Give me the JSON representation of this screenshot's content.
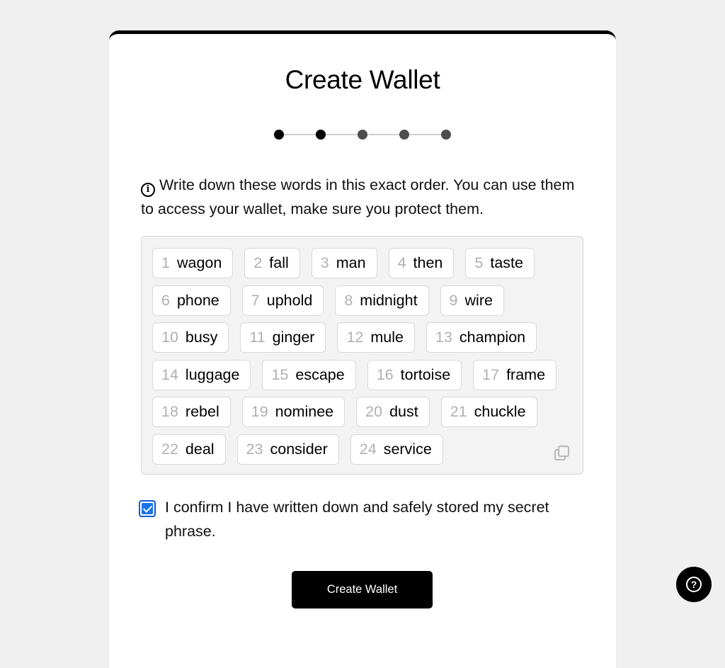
{
  "page": {
    "title": "Create Wallet"
  },
  "stepper": {
    "total_steps": 5,
    "completed_steps": 2,
    "colors": {
      "done": "#000000",
      "pending": "#4d4d4d",
      "line": "#cfcfcf"
    }
  },
  "info": {
    "icon": "info-circle-icon",
    "text": "Write down these words in this exact order. You can use them to access your wallet, make sure you protect them."
  },
  "seed_phrase": {
    "words": [
      {
        "num": "1",
        "word": "wagon"
      },
      {
        "num": "2",
        "word": "fall"
      },
      {
        "num": "3",
        "word": "man"
      },
      {
        "num": "4",
        "word": "then"
      },
      {
        "num": "5",
        "word": "taste"
      },
      {
        "num": "6",
        "word": "phone"
      },
      {
        "num": "7",
        "word": "uphold"
      },
      {
        "num": "8",
        "word": "midnight"
      },
      {
        "num": "9",
        "word": "wire"
      },
      {
        "num": "10",
        "word": "busy"
      },
      {
        "num": "11",
        "word": "ginger"
      },
      {
        "num": "12",
        "word": "mule"
      },
      {
        "num": "13",
        "word": "champion"
      },
      {
        "num": "14",
        "word": "luggage"
      },
      {
        "num": "15",
        "word": "escape"
      },
      {
        "num": "16",
        "word": "tortoise"
      },
      {
        "num": "17",
        "word": "frame"
      },
      {
        "num": "18",
        "word": "rebel"
      },
      {
        "num": "19",
        "word": "nominee"
      },
      {
        "num": "20",
        "word": "dust"
      },
      {
        "num": "21",
        "word": "chuckle"
      },
      {
        "num": "22",
        "word": "deal"
      },
      {
        "num": "23",
        "word": "consider"
      },
      {
        "num": "24",
        "word": "service"
      }
    ],
    "copy_icon": "copy-icon"
  },
  "confirm": {
    "checked": true,
    "label": "I confirm I have written down and safely stored my secret phrase.",
    "accent": "#1a73e8"
  },
  "actions": {
    "create_label": "Create Wallet"
  },
  "help": {
    "icon": "question-circle-icon",
    "glyph": "?"
  }
}
